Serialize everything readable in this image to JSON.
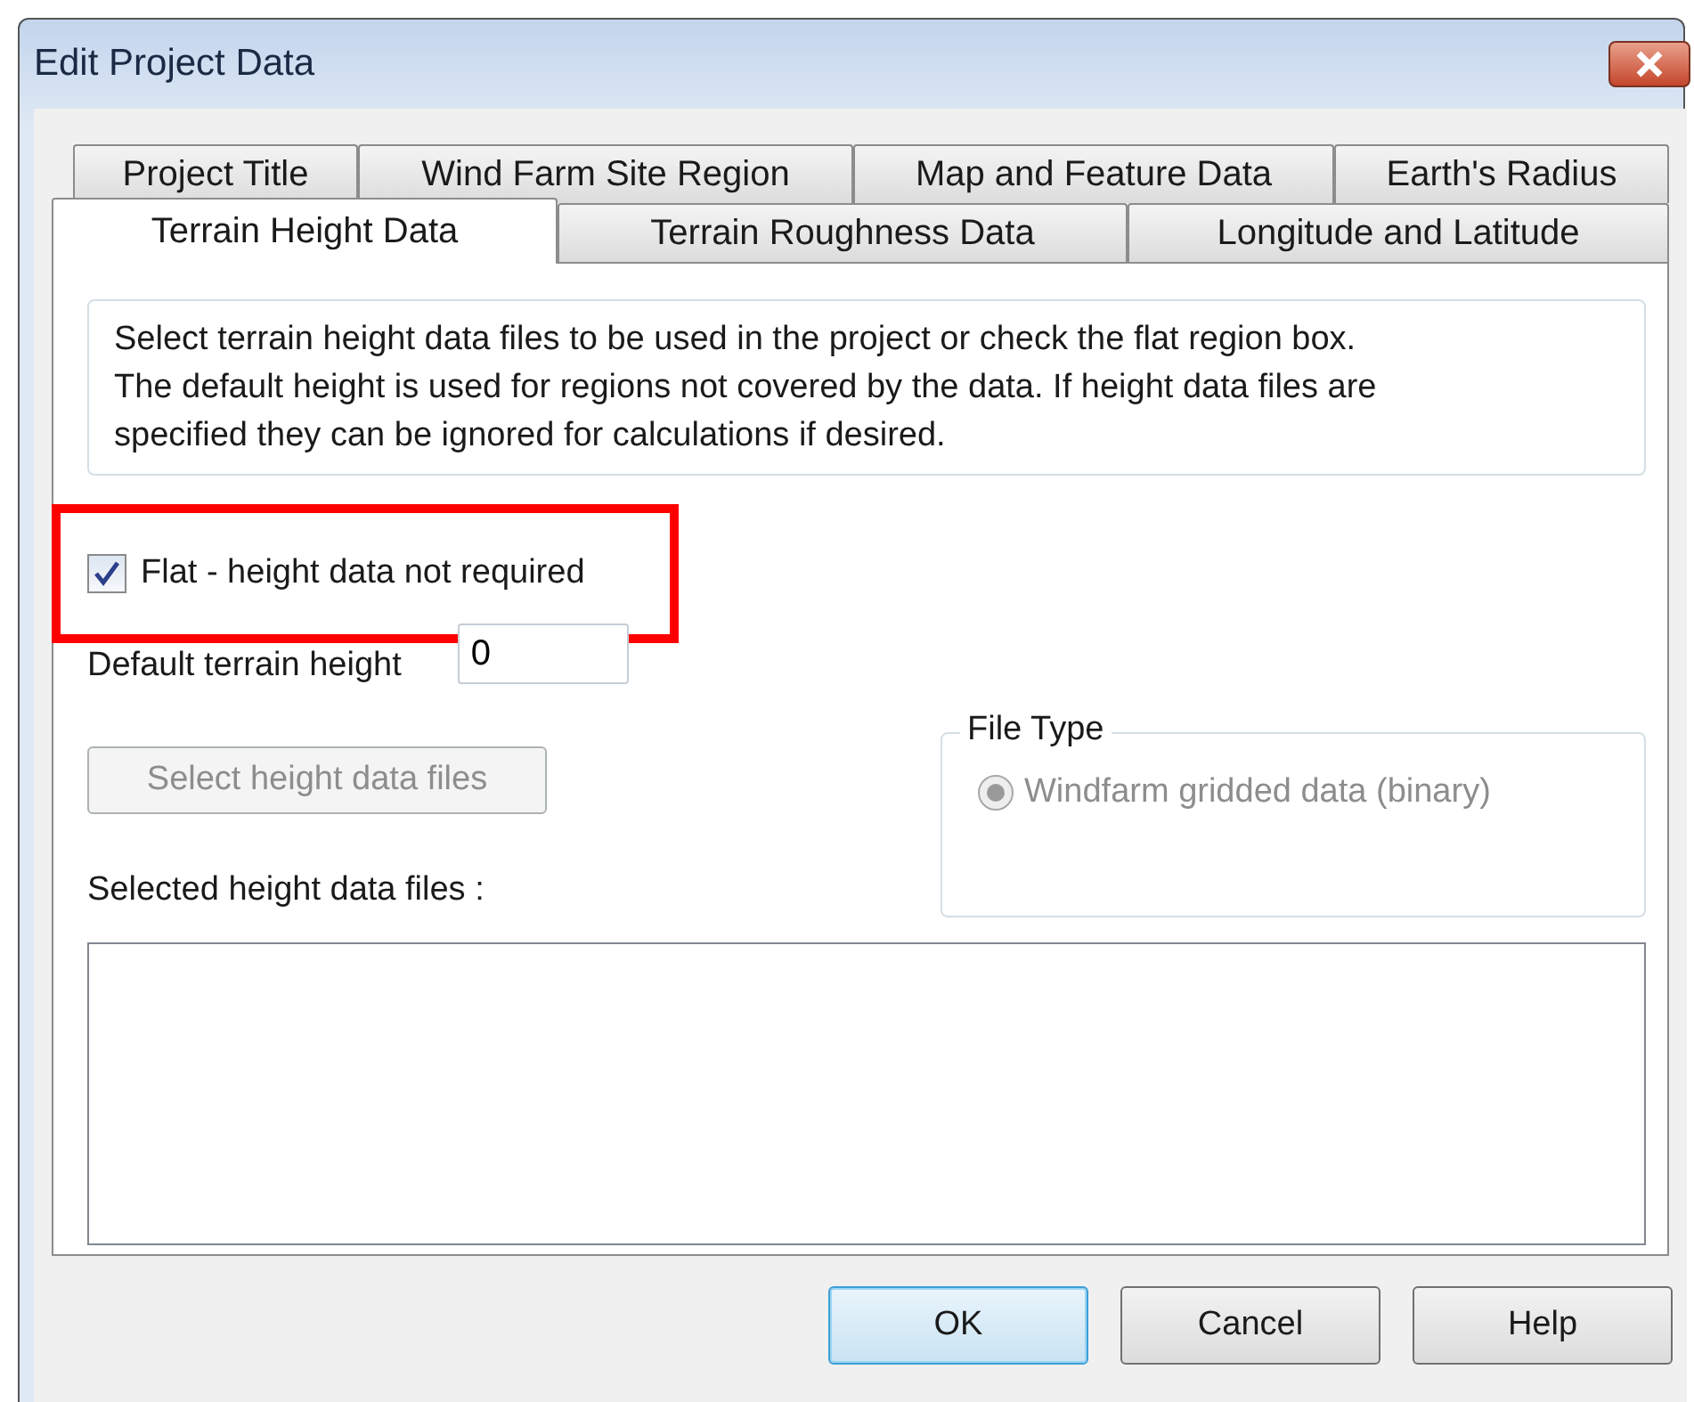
{
  "window": {
    "title": "Edit Project Data"
  },
  "tab_rows": [
    {
      "tabs": [
        {
          "label": "Project Title",
          "selected": false
        },
        {
          "label": "Wind Farm Site Region",
          "selected": false
        },
        {
          "label": "Map and Feature Data",
          "selected": false
        },
        {
          "label": "Earth's Radius",
          "selected": false
        }
      ]
    },
    {
      "tabs": [
        {
          "label": "Terrain Height Data",
          "selected": true
        },
        {
          "label": "Terrain Roughness Data",
          "selected": false
        },
        {
          "label": "Longitude and Latitude",
          "selected": false
        }
      ]
    }
  ],
  "description": "Select terrain height data files to be used in the project or check the flat region box.\nThe default height is used for regions not covered by the data.  If height data files are\nspecified they can be ignored for calculations if desired.",
  "flat_checkbox": {
    "label": "Flat - height data not required",
    "checked": true
  },
  "default_height": {
    "label": "Default terrain height",
    "value": "0"
  },
  "select_button": {
    "label": "Select height data files",
    "disabled": true
  },
  "file_type": {
    "title": "File Type",
    "options": [
      {
        "label": "Windfarm gridded data (binary)",
        "selected": true,
        "disabled": true
      }
    ]
  },
  "selected_files": {
    "label": "Selected height data files :"
  },
  "buttons": [
    {
      "label": "OK",
      "default": true
    },
    {
      "label": "Cancel",
      "default": false
    },
    {
      "label": "Help",
      "default": false
    }
  ]
}
